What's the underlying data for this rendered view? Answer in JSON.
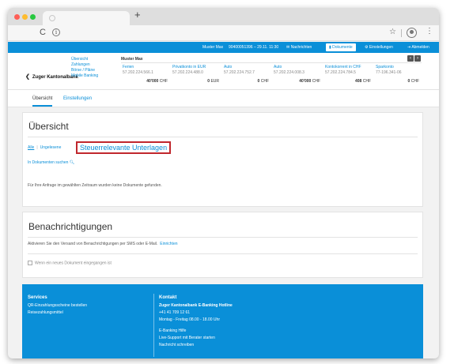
{
  "browser": {
    "new_tab": "+",
    "reload": "C",
    "info": "i",
    "star": "☆",
    "menu": "⋮"
  },
  "topbar": {
    "user": "Muster Max",
    "session": "90400051396 – 29.11. 11:30",
    "messages": "Nachrichten",
    "documents": "Dokumente",
    "settings": "Einstellungen",
    "logout": "Abmelden"
  },
  "bank": {
    "logo": "Zuger Kantonalbank",
    "nav": [
      "Übersicht",
      "Zahlungen",
      "Börse / Pläne",
      "Mobile Banking"
    ],
    "owner": "Muster Max",
    "accounts": [
      {
        "name": "Ferien",
        "number": "57.202.224.566.1",
        "balance": "40'000",
        "currency": "CHF"
      },
      {
        "name": "Privatkonto in EUR",
        "number": "57.202.224.488.0",
        "balance": "0",
        "currency": "EUR"
      },
      {
        "name": "Auto",
        "number": "57.202.224.752.7",
        "balance": "0",
        "currency": "CHF"
      },
      {
        "name": "Auto",
        "number": "57.202.224.008.3",
        "balance": "40'000",
        "currency": "CHF"
      },
      {
        "name": "Kontokorrent in CHF",
        "number": "57.202.224.784.5",
        "balance": "408",
        "currency": "CHF"
      },
      {
        "name": "Sparkonto",
        "number": "77-196.341-06",
        "balance": "0",
        "currency": "CHF"
      }
    ],
    "prev": "‹",
    "next": "›"
  },
  "subnav": {
    "overview": "Übersicht",
    "settings": "Einstellungen"
  },
  "overview": {
    "title": "Übersicht",
    "filter_all": "Alle",
    "filter_sep": "|",
    "filter_unread": "Ungelesene",
    "tax_docs": "Steuerrelevante Unterlagen",
    "search": "In Dokumenten suchen",
    "empty": "Für Ihre Anfrage im gewählten Zeitraum wurden keine Dokumente gefunden."
  },
  "notifications": {
    "title": "Benachrichtigungen",
    "text": "Aktivieren Sie den Versand von Benachrichtigungen per SMS oder E-Mail.",
    "link": "Einrichten",
    "checkbox": "Wenn ein neues Dokument eingegangen ist"
  },
  "footer": {
    "services_title": "Services",
    "services": [
      "QR-Einzahlungsscheine bestellen",
      "Reisezahlungsmittel"
    ],
    "contact_title": "Kontakt",
    "contact": [
      "Zuger Kantonalbank E-Banking Hotline",
      "+41 41 709 12 61",
      "Montag - Freitag 08.00 - 18.00 Uhr",
      "",
      "E-Banking Hilfe",
      "Live-Support mit Berater starten",
      "Nachricht schreiben"
    ]
  },
  "colors": {
    "accent": "#0a8fd8",
    "highlight": "#c0272d"
  }
}
